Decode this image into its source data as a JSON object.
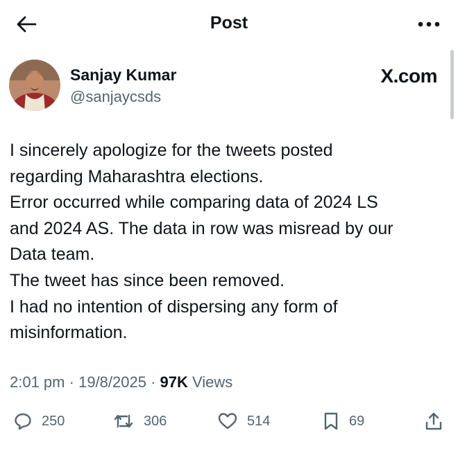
{
  "header": {
    "title": "Post"
  },
  "author": {
    "name": "Sanjay Kumar",
    "handle": "@sanjaycsds"
  },
  "source_mark": "X.com",
  "tweet": {
    "lines": [
      "I sincerely apologize for the tweets posted",
      "regarding Maharashtra elections.",
      "Error occurred while comparing data of 2024 LS",
      "and 2024 AS. The data in row was misread by our",
      "Data team.",
      "The tweet has since been removed.",
      "I had no intention of dispersing any form of",
      "misinformation."
    ]
  },
  "meta": {
    "time": "2:01 pm",
    "separator": "·",
    "date": "19/8/2025",
    "views_count": "97K",
    "views_label": "Views"
  },
  "actions": {
    "replies": "250",
    "reposts": "306",
    "likes": "514",
    "bookmarks": "69"
  },
  "icons": {
    "back": "arrow-left-icon",
    "more": "more-horizontal-icon",
    "reply": "reply-bubble-icon",
    "repost": "repost-icon",
    "like": "heart-icon",
    "bookmark": "bookmark-icon",
    "share": "share-icon"
  },
  "colors": {
    "text": "#0f1419",
    "secondary": "#536471",
    "background": "#ffffff"
  }
}
